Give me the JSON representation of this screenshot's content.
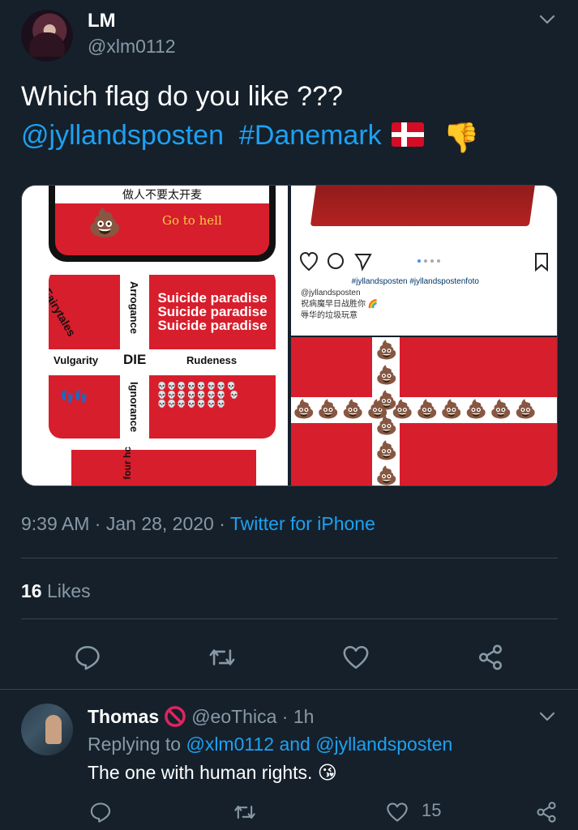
{
  "tweet": {
    "author_name": "LM",
    "author_handle": "@xlm0112",
    "text_line1": "Which flag do you like ???",
    "mention": "@jyllandsposten",
    "hashtag": "#Danemark",
    "flag_emoji": "flag-denmark",
    "thumb_emoji": "👎",
    "time": "9:39 AM",
    "date": "Jan 28, 2020",
    "source": "Twitter for iPhone",
    "likes_count": "16",
    "likes_label": "Likes"
  },
  "media": {
    "left": {
      "go_to_hell": "Go to hell",
      "suicide_lines": [
        "Suicide paradise",
        "Suicide paradise",
        "Suicide paradise"
      ],
      "fairytales": "Fairytales",
      "arrogance": "Arrogance",
      "vulgarity": "Vulgarity",
      "die": "DIE",
      "rudeness": "Rudeness",
      "ignorance": "Ignorance",
      "four_h": "four hc"
    },
    "right_top": {
      "hashtags": "#jyllandsposten #jyllandspostenfoto",
      "account": "@jyllandsposten"
    }
  },
  "actions": {
    "reply_icon": "reply-icon",
    "retweet_icon": "retweet-icon",
    "like_icon": "heart-icon",
    "share_icon": "share-icon"
  },
  "reply": {
    "name": "Thomas",
    "handle": "@eoThica",
    "age": "1h",
    "replying_label": "Replying to",
    "replying_to_1": "@xlm0112",
    "replying_and": "and",
    "replying_to_2": "@jyllandsposten",
    "text": "The one with human rights.",
    "emoji": "😘",
    "like_count": "15"
  },
  "colors": {
    "background": "#15202b",
    "link": "#1da1f2",
    "muted": "#8899a6",
    "border": "#38444d"
  }
}
